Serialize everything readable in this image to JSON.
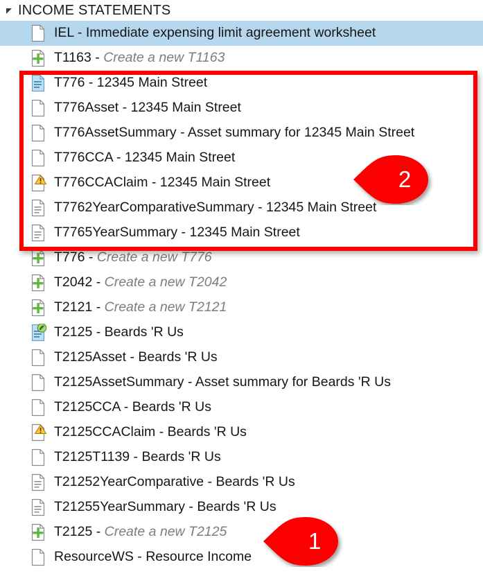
{
  "colors": {
    "highlight_box": "#FA0000",
    "callout_fill": "#FA0000",
    "selected_row": "#B5D7EE",
    "blue_document": "#BEE0F4",
    "green_plus": "#5FB83D",
    "warning_yellow": "#FFC83C",
    "muted_text": "#7D7D7D"
  },
  "group": {
    "expander_icon": "triangle-collapse-icon",
    "title": "INCOME STATEMENTS"
  },
  "rows": [
    {
      "icon": "blank-document-icon",
      "name": "IEL",
      "separator": " - ",
      "desc": "Immediate expensing limit agreement worksheet",
      "muted": false,
      "selected": true
    },
    {
      "icon": "new-document-icon",
      "name": "T1163",
      "separator": " - ",
      "desc": "Create a new T1163",
      "muted": true,
      "selected": false
    },
    {
      "icon": "filled-document-icon",
      "name": "T776",
      "separator": " - ",
      "desc": "12345 Main Street",
      "muted": false,
      "selected": false
    },
    {
      "icon": "blank-document-icon",
      "name": "T776Asset",
      "separator": " - ",
      "desc": "12345 Main Street",
      "muted": false,
      "selected": false
    },
    {
      "icon": "blank-document-icon",
      "name": "T776AssetSummary",
      "separator": " - ",
      "desc": "Asset summary for 12345 Main Street",
      "muted": false,
      "selected": false
    },
    {
      "icon": "blank-document-icon",
      "name": "T776CCA",
      "separator": " - ",
      "desc": "12345 Main Street",
      "muted": false,
      "selected": false
    },
    {
      "icon": "warning-document-icon",
      "name": "T776CCAClaim",
      "separator": " - ",
      "desc": "12345 Main Street",
      "muted": false,
      "selected": false
    },
    {
      "icon": "lined-document-icon",
      "name": "T7762YearComparativeSummary",
      "separator": " - ",
      "desc": "12345 Main Street",
      "muted": false,
      "selected": false
    },
    {
      "icon": "lined-document-icon",
      "name": "T7765YearSummary",
      "separator": " - ",
      "desc": "12345 Main Street",
      "muted": false,
      "selected": false
    },
    {
      "icon": "new-document-icon",
      "name": "T776",
      "separator": " - ",
      "desc": "Create a new T776",
      "muted": true,
      "selected": false
    },
    {
      "icon": "new-document-icon",
      "name": "T2042",
      "separator": " - ",
      "desc": "Create a new T2042",
      "muted": true,
      "selected": false
    },
    {
      "icon": "new-document-icon",
      "name": "T2121",
      "separator": " - ",
      "desc": "Create a new T2121",
      "muted": true,
      "selected": false
    },
    {
      "icon": "signed-document-icon",
      "name": "T2125",
      "separator": " - ",
      "desc": "Beards 'R Us",
      "muted": false,
      "selected": false
    },
    {
      "icon": "blank-document-icon",
      "name": "T2125Asset",
      "separator": " - ",
      "desc": "Beards 'R Us",
      "muted": false,
      "selected": false
    },
    {
      "icon": "blank-document-icon",
      "name": "T2125AssetSummary",
      "separator": " - ",
      "desc": "Asset summary for Beards 'R Us",
      "muted": false,
      "selected": false
    },
    {
      "icon": "blank-document-icon",
      "name": "T2125CCA",
      "separator": " - ",
      "desc": "Beards 'R Us",
      "muted": false,
      "selected": false
    },
    {
      "icon": "warning-document-icon",
      "name": "T2125CCAClaim",
      "separator": " - ",
      "desc": "Beards 'R Us",
      "muted": false,
      "selected": false
    },
    {
      "icon": "blank-document-icon",
      "name": "T2125T1139",
      "separator": " - ",
      "desc": "Beards 'R Us",
      "muted": false,
      "selected": false
    },
    {
      "icon": "lined-document-icon",
      "name": "T21252YearComparative",
      "separator": " - ",
      "desc": "Beards 'R Us",
      "muted": false,
      "selected": false
    },
    {
      "icon": "lined-document-icon",
      "name": "T21255YearSummary",
      "separator": " - ",
      "desc": "Beards 'R Us",
      "muted": false,
      "selected": false
    },
    {
      "icon": "new-document-icon",
      "name": "T2125",
      "separator": " - ",
      "desc": "Create a new T2125",
      "muted": true,
      "selected": false
    },
    {
      "icon": "blank-document-icon",
      "name": "ResourceWS",
      "separator": " - ",
      "desc": "Resource Income",
      "muted": false,
      "selected": false
    }
  ],
  "callouts": [
    {
      "id": "1",
      "label": "1"
    },
    {
      "id": "2",
      "label": "2"
    }
  ]
}
